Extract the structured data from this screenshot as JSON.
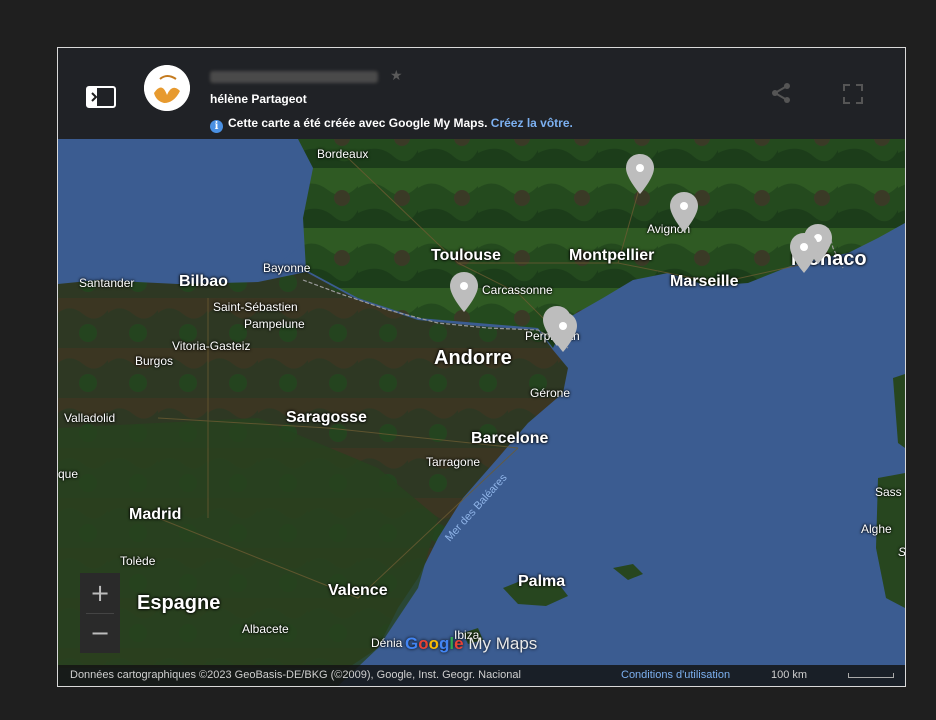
{
  "header": {
    "author": "hélène Partageot",
    "notice_text": "Cette carte a été créée avec Google My Maps.",
    "notice_link": "Créez la vôtre."
  },
  "icons": [
    "panel-toggle-icon",
    "info-icon",
    "star-icon",
    "share-icon",
    "fullscreen-icon",
    "zoom-in-icon",
    "zoom-out-icon",
    "map-marker-icon"
  ],
  "zoom": {
    "in_label": "+",
    "out_label": "−"
  },
  "places": {
    "bordeaux": "Bordeaux",
    "toulouse": "Toulouse",
    "montpellier": "Montpellier",
    "avignon": "Avignon",
    "marseille": "Marseille",
    "monaco": "Monaco",
    "bayonne": "Bayonne",
    "santander": "Santander",
    "bilbao": "Bilbao",
    "saint_sebastien": "Saint-Sébastien",
    "pampelune": "Pampelune",
    "vitoria": "Vitoria-Gasteiz",
    "burgos": "Burgos",
    "carcassonne": "Carcassonne",
    "perpignan": "Perpignan",
    "andorre": "Andorre",
    "gerone": "Gérone",
    "valladolid": "Valladolid",
    "saragosse": "Saragosse",
    "barcelone": "Barcelone",
    "tarragone": "Tarragone",
    "que": "que",
    "madrid": "Madrid",
    "tolede": "Tolède",
    "espagne": "Espagne",
    "valence": "Valence",
    "albacete": "Albacete",
    "denia": "Dénia",
    "ibiza": "Ibiza",
    "palma": "Palma",
    "mer_des_baleares": "Mer des Baléares",
    "sassari": "Sass",
    "alghero": "Alghe",
    "s": "S"
  },
  "branding": {
    "google": "Google",
    "mymaps": "My Maps"
  },
  "footer": {
    "attribution": "Données cartographiques ©2023 GeoBasis-DE/BKG (©2009), Google, Inst. Geogr. Nacional",
    "terms": "Conditions d'utilisation",
    "scale": "100 km"
  },
  "markers": [
    {
      "name": "marker-toulouse-area"
    },
    {
      "name": "marker-rhone-valley"
    },
    {
      "name": "marker-avignon"
    },
    {
      "name": "marker-monaco-1"
    },
    {
      "name": "marker-monaco-2"
    },
    {
      "name": "marker-perpignan-1"
    },
    {
      "name": "marker-perpignan-2"
    }
  ],
  "colors": {
    "sea": "#3b5c91",
    "land": "#1e4a1f",
    "topbar": "#1e1e1e",
    "link": "#7cb0f0",
    "marker": "#bdbdbd"
  }
}
